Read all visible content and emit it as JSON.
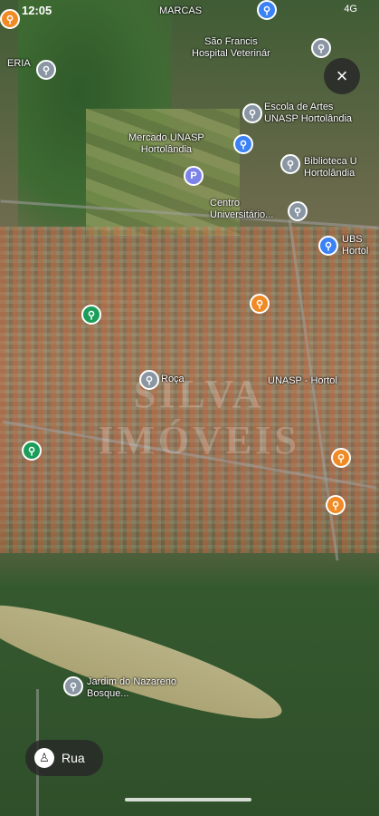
{
  "status_bar": {
    "time": "12:05",
    "signal": "4G"
  },
  "places": {
    "marcas": "MARCAS",
    "hospital": "São Francis\nHospital Veterinár",
    "escola": "Escola de Artes\nUNASP Hortolândia",
    "mercado": "Mercado UNASP\nHortolândia",
    "biblioteca": "Biblioteca U\nHortolândia",
    "centro": "Centro\nUniversitário...",
    "ubs": "UBS\nHortol",
    "eria": "ERIA",
    "nazareno": "Jardim do Nazareno\nBosque...",
    "roca": "Roça",
    "unasp_mid": "UNASP - Hortol"
  },
  "controls": {
    "close": "×",
    "street_view_label": "Rua"
  },
  "colors": {
    "pin_gray": "#8a96a3",
    "pin_blue": "#3b82f6",
    "pin_orange": "#f08a24",
    "pin_green": "#1b9e5a"
  }
}
